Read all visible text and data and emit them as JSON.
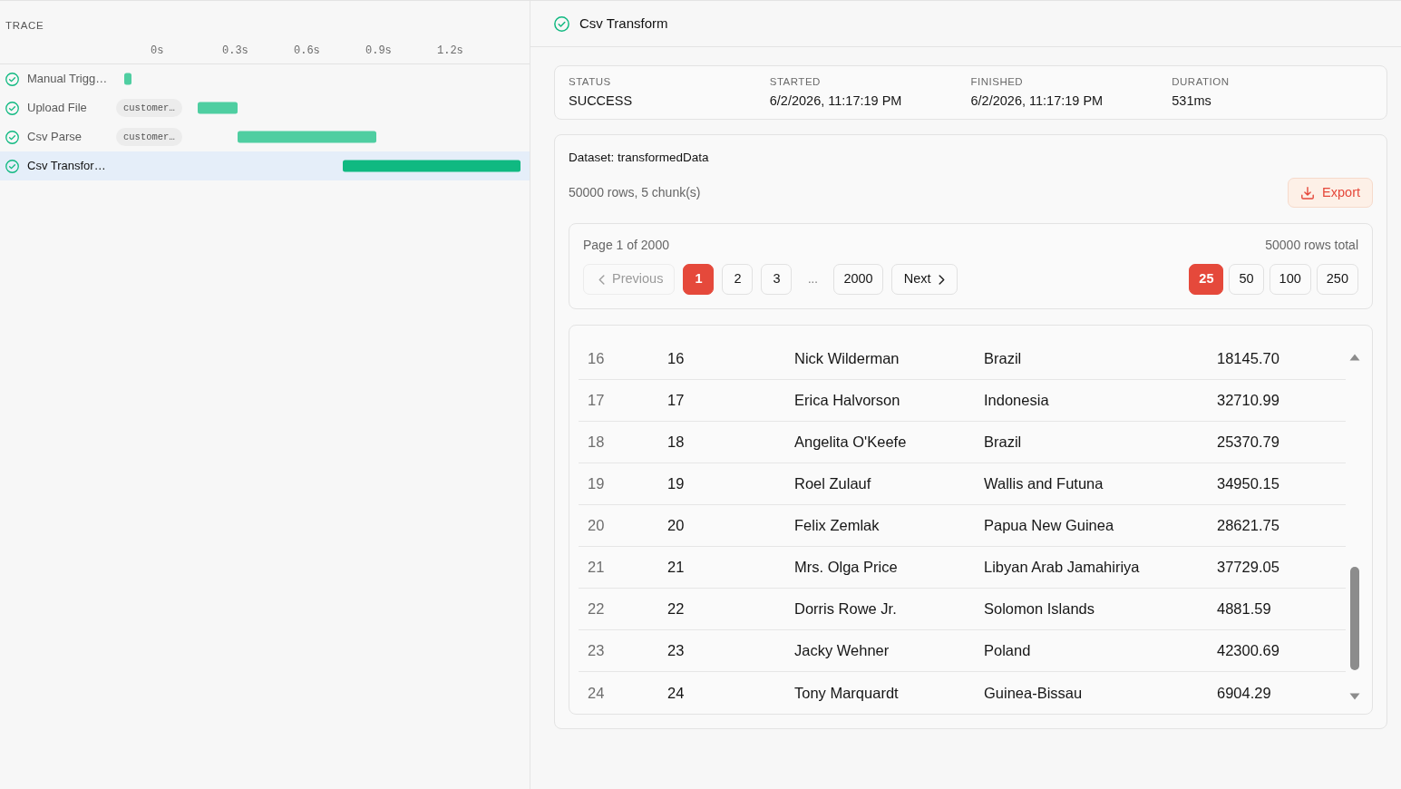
{
  "trace": {
    "title": "TRACE",
    "axis_labels": [
      "0s",
      "0.3s",
      "0.6s",
      "0.9s",
      "1.2s"
    ],
    "spans": [
      {
        "name": "Manual Trigg…",
        "success": true,
        "selected": false
      },
      {
        "name": "Upload File",
        "input": "customer…",
        "success": true,
        "selected": false
      },
      {
        "name": "Csv Parse",
        "input": "customer…",
        "success": true,
        "selected": false
      },
      {
        "name": "Csv Transfor…",
        "success": true,
        "selected": true
      }
    ]
  },
  "detail": {
    "title": "Csv Transform",
    "success": true,
    "summary": [
      {
        "label": "STATUS",
        "value": "SUCCESS"
      },
      {
        "label": "STARTED",
        "value": "6/2/2026, 11:17:19 PM"
      },
      {
        "label": "FINISHED",
        "value": "6/2/2026, 11:17:19 PM"
      },
      {
        "label": "DURATION",
        "value": "531ms"
      }
    ],
    "dataset": {
      "title": "Dataset: transformedData",
      "meta": "50000 rows, 5 chunk(s)",
      "export_button": "Export",
      "pagination": {
        "page_info": "Page 1 of 2000",
        "total_rows": "50000 rows total",
        "previous": {
          "label": "Previous",
          "disabled": true
        },
        "pages": [
          {
            "kind": "page",
            "label": "1",
            "selected": true
          },
          {
            "kind": "page",
            "label": "2",
            "selected": false
          },
          {
            "kind": "page",
            "label": "3",
            "selected": false
          },
          {
            "kind": "ellipsis",
            "label": "..."
          },
          {
            "kind": "page",
            "label": "2000",
            "selected": false
          }
        ],
        "next": {
          "label": "Next",
          "disabled": false
        },
        "page_sizes": [
          {
            "label": "25",
            "selected": true
          },
          {
            "label": "50",
            "selected": false
          },
          {
            "label": "100",
            "selected": false
          },
          {
            "label": "250",
            "selected": false
          }
        ]
      },
      "table": {
        "rows": [
          [
            "16",
            "16",
            "Nick Wilderman",
            "Brazil",
            "18145.70"
          ],
          [
            "17",
            "17",
            "Erica Halvorson",
            "Indonesia",
            "32710.99"
          ],
          [
            "18",
            "18",
            "Angelita O'Keefe",
            "Brazil",
            "25370.79"
          ],
          [
            "19",
            "19",
            "Roel Zulauf",
            "Wallis and Futuna",
            "34950.15"
          ],
          [
            "20",
            "20",
            "Felix Zemlak",
            "Papua New Guinea",
            "28621.75"
          ],
          [
            "21",
            "21",
            "Mrs. Olga Price",
            "Libyan Arab Jamahiriya",
            "37729.05"
          ],
          [
            "22",
            "22",
            "Dorris Rowe Jr.",
            "Solomon Islands",
            "4881.59"
          ],
          [
            "23",
            "23",
            "Jacky Wehner",
            "Poland",
            "42300.69"
          ],
          [
            "24",
            "24",
            "Tony Marquardt",
            "Guinea-Bissau",
            "6904.29"
          ]
        ]
      }
    }
  }
}
